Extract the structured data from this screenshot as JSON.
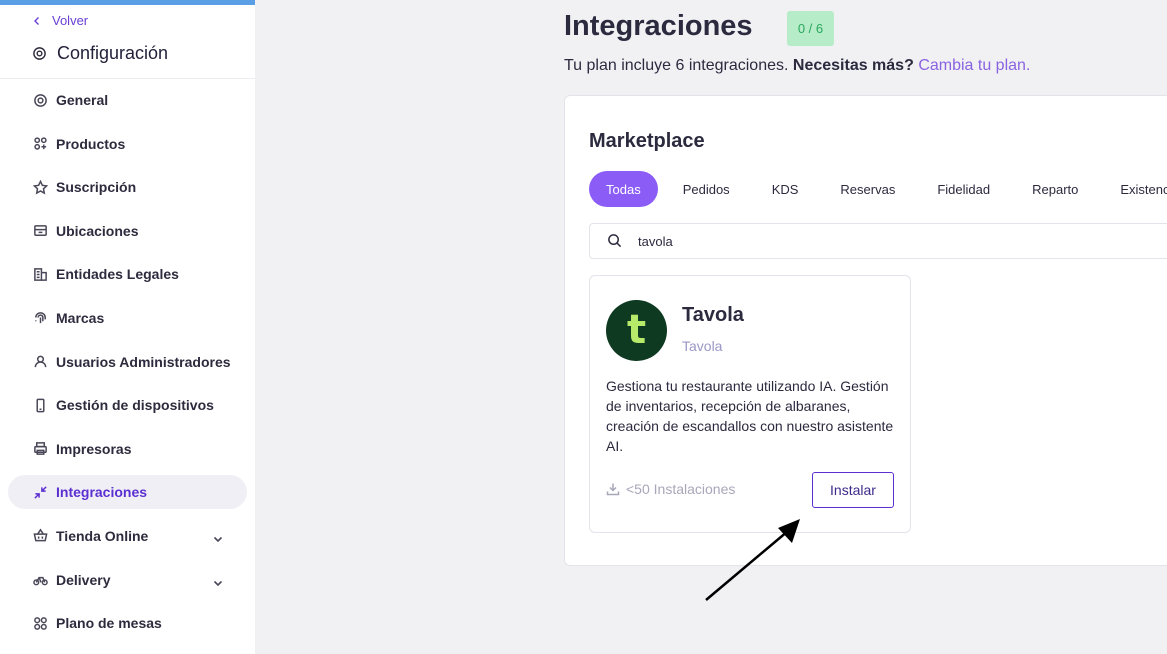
{
  "sidebar": {
    "back_label": "Volver",
    "title": "Configuración",
    "items": [
      {
        "label": "General",
        "icon": "gear-icon"
      },
      {
        "label": "Productos",
        "icon": "products-icon"
      },
      {
        "label": "Suscripción",
        "icon": "star-icon"
      },
      {
        "label": "Ubicaciones",
        "icon": "store-icon"
      },
      {
        "label": "Entidades Legales",
        "icon": "building-icon"
      },
      {
        "label": "Marcas",
        "icon": "fingerprint-icon"
      },
      {
        "label": "Usuarios Administradores",
        "icon": "user-icon"
      },
      {
        "label": "Gestión de dispositivos",
        "icon": "phone-icon"
      },
      {
        "label": "Impresoras",
        "icon": "printer-icon"
      },
      {
        "label": "Integraciones",
        "icon": "integrations-icon",
        "active": true
      },
      {
        "label": "Tienda Online",
        "icon": "basket-icon",
        "expandable": true
      },
      {
        "label": "Delivery",
        "icon": "bike-icon",
        "expandable": true
      },
      {
        "label": "Plano de mesas",
        "icon": "tables-icon"
      }
    ]
  },
  "main": {
    "title": "Integraciones",
    "count_badge": "0 / 6",
    "plan_text": "Tu plan incluye 6 integraciones.",
    "plan_question": "Necesitas más?",
    "plan_link": "Cambia tu plan.",
    "marketplace": {
      "title": "Marketplace",
      "tabs": [
        "Todas",
        "Pedidos",
        "KDS",
        "Reservas",
        "Fidelidad",
        "Reparto",
        "Existencias"
      ],
      "active_tab": "Todas",
      "search_value": "tavola",
      "cards": [
        {
          "name": "Tavola",
          "subtitle": "Tavola",
          "logo_letter": "t",
          "description": "Gestiona tu restaurante utilizando IA. Gestión de inventarios, recepción de albaranes, creación de escandallos con nuestro asistente AI.",
          "installs": "<50 Instalaciones",
          "install_label": "Instalar"
        }
      ]
    }
  },
  "colors": {
    "accent": "#8b5cf6",
    "active_nav": "#5b2fd1",
    "badge_bg": "#b6ecc7",
    "badge_text": "#28a85e",
    "logo_bg": "#0f3a22",
    "logo_letter": "#b7ea6b",
    "top_bar": "#5a9ee6"
  }
}
